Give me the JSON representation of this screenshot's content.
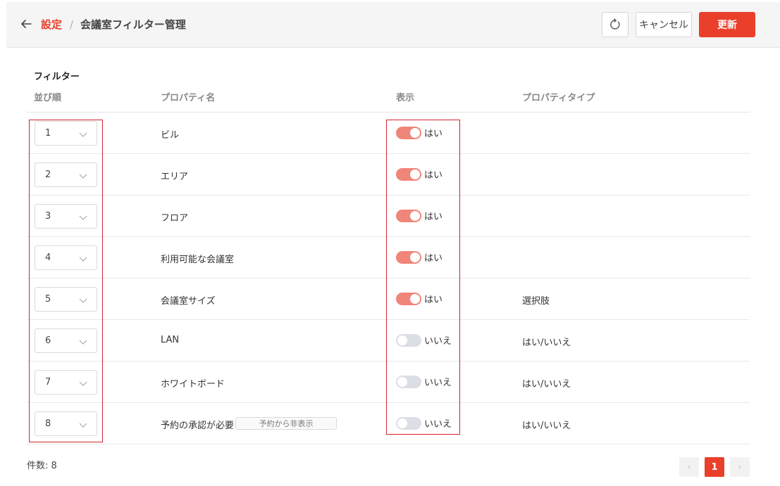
{
  "header": {
    "breadcrumb_link": "設定",
    "breadcrumb_separator": "/",
    "breadcrumb_current": "会議室フィルター管理",
    "cancel_label": "キャンセル",
    "update_label": "更新"
  },
  "colors": {
    "accent": "#ea3f2a",
    "toggle_on": "#f0857a",
    "toggle_off": "#dcdee6",
    "highlight_box": "#d0232c"
  },
  "section": {
    "title": "フィルター"
  },
  "table": {
    "columns": {
      "order": "並び順",
      "name": "プロパティ名",
      "show": "表示",
      "type": "プロパティタイプ"
    },
    "rows": [
      {
        "order": "1",
        "name": "ビル",
        "show_label": "はい",
        "enabled": true,
        "type": ""
      },
      {
        "order": "2",
        "name": "エリア",
        "show_label": "はい",
        "enabled": true,
        "type": ""
      },
      {
        "order": "3",
        "name": "フロア",
        "show_label": "はい",
        "enabled": true,
        "type": ""
      },
      {
        "order": "4",
        "name": "利用可能な会議室",
        "show_label": "はい",
        "enabled": true,
        "type": ""
      },
      {
        "order": "5",
        "name": "会議室サイズ",
        "show_label": "はい",
        "enabled": true,
        "type": "選択肢"
      },
      {
        "order": "6",
        "name": "LAN",
        "show_label": "いいえ",
        "enabled": false,
        "type": "はい/いいえ"
      },
      {
        "order": "7",
        "name": "ホワイトボード",
        "show_label": "いいえ",
        "enabled": false,
        "type": "はい/いいえ"
      },
      {
        "order": "8",
        "name": "予約の承認が必要",
        "tag": "予約から非表示",
        "show_label": "いいえ",
        "enabled": false,
        "type": "はい/いいえ"
      }
    ]
  },
  "footer": {
    "count_label": "件数: 8",
    "pagination": {
      "prev": "‹",
      "current": "1",
      "next": "›"
    }
  },
  "icons": {
    "back": "arrow-left-icon",
    "refresh": "refresh-icon",
    "chevron": "chevron-down-icon"
  }
}
